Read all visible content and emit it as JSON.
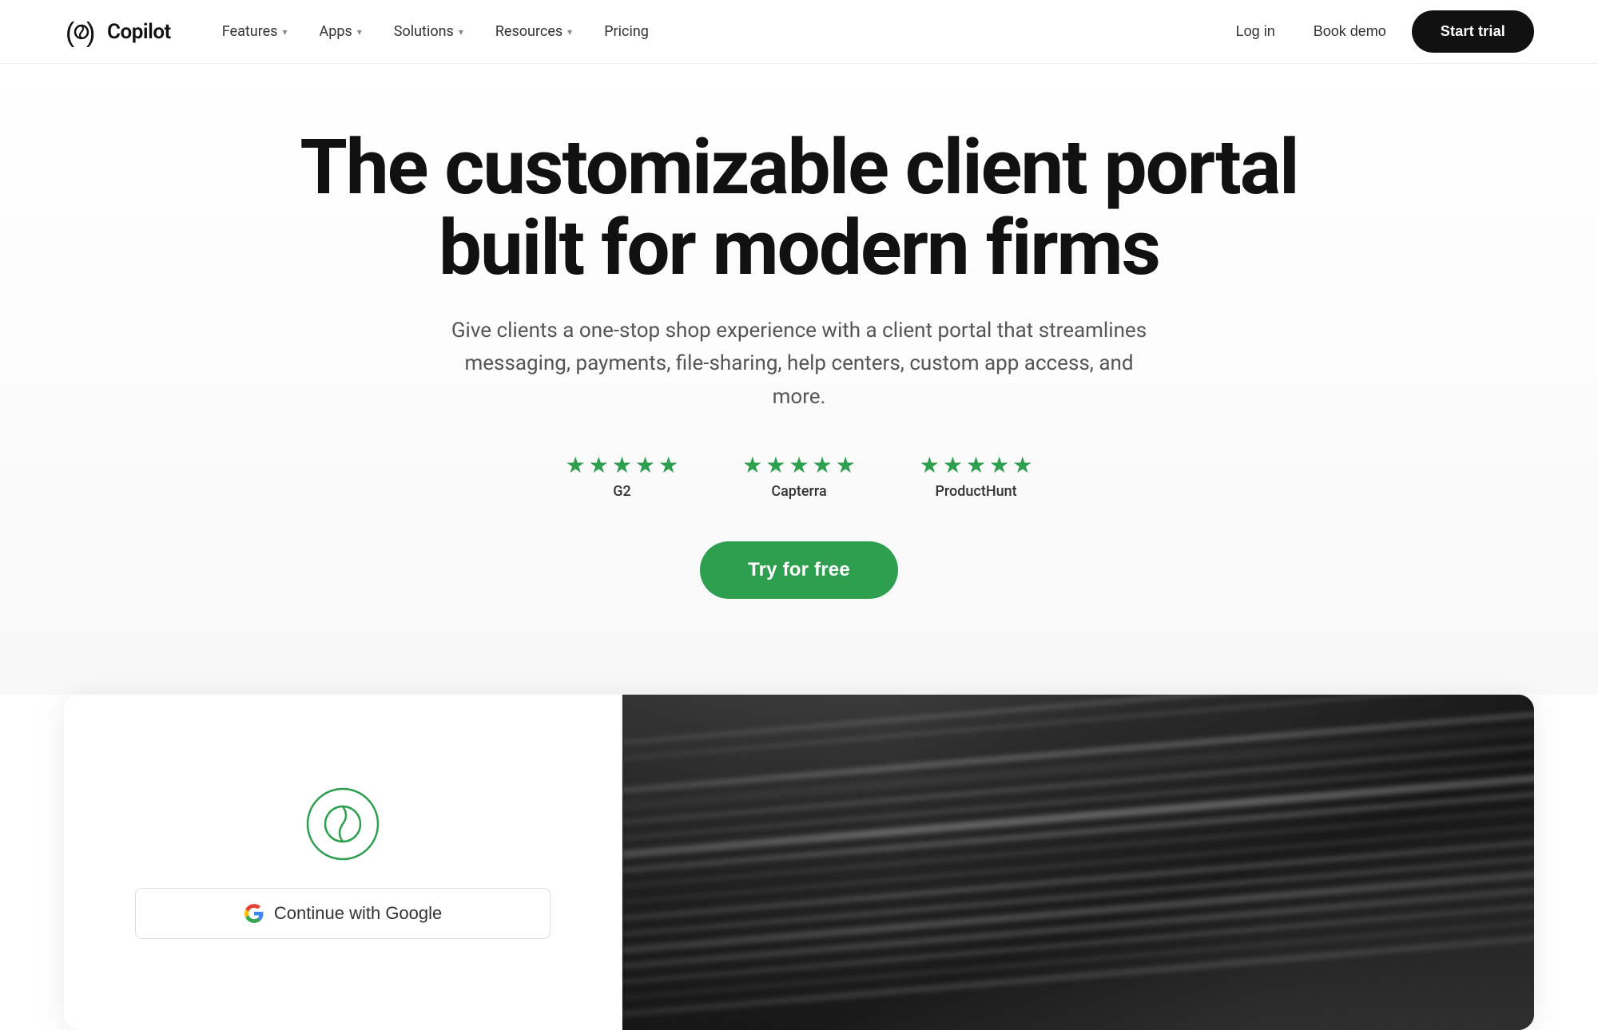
{
  "meta": {
    "title": "Copilot - The customizable client portal built for modern firms"
  },
  "nav": {
    "logo_text": "Copilot",
    "links": [
      {
        "label": "Features",
        "id": "features"
      },
      {
        "label": "Apps",
        "id": "apps"
      },
      {
        "label": "Solutions",
        "id": "solutions"
      },
      {
        "label": "Resources",
        "id": "resources"
      },
      {
        "label": "Pricing",
        "id": "pricing"
      }
    ],
    "login_label": "Log in",
    "book_demo_label": "Book demo",
    "start_trial_label": "Start trial"
  },
  "hero": {
    "title": "The customizable client portal built for modern firms",
    "subtitle": "Give clients a one-stop shop experience with a client portal that streamlines messaging, payments, file-sharing, help centers, custom app access, and more.",
    "cta_button_label": "Try for free",
    "ratings": [
      {
        "platform": "G2",
        "stars": 5
      },
      {
        "platform": "Capterra",
        "stars": 5
      },
      {
        "platform": "ProductHunt",
        "stars": 5
      }
    ]
  },
  "preview": {
    "continue_google_label": "Continue with Google"
  },
  "colors": {
    "green": "#2e9e4f",
    "dark": "#111111",
    "white": "#ffffff"
  }
}
